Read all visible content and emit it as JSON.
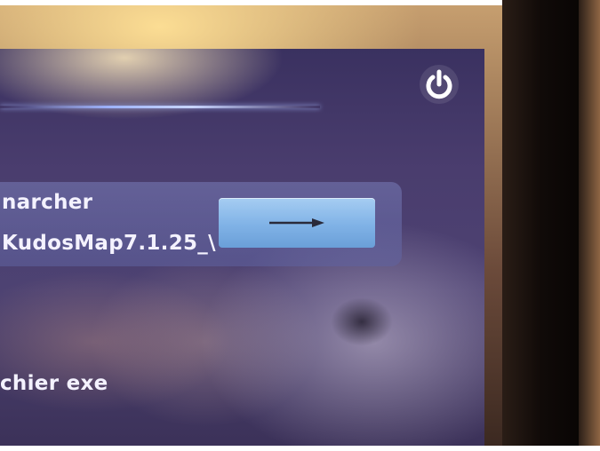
{
  "screen": {
    "panel": {
      "title": "narcher",
      "value": "KudosMap7.1.25_\\"
    },
    "file_label": "chier exe"
  },
  "icons": {
    "power": "power-icon",
    "arrow": "arrow-right-icon"
  },
  "colors": {
    "screen_background": "#463b6a",
    "button": "#80b2e6",
    "text": "#f4f2ff",
    "progress_line": "#c8d4ff"
  }
}
